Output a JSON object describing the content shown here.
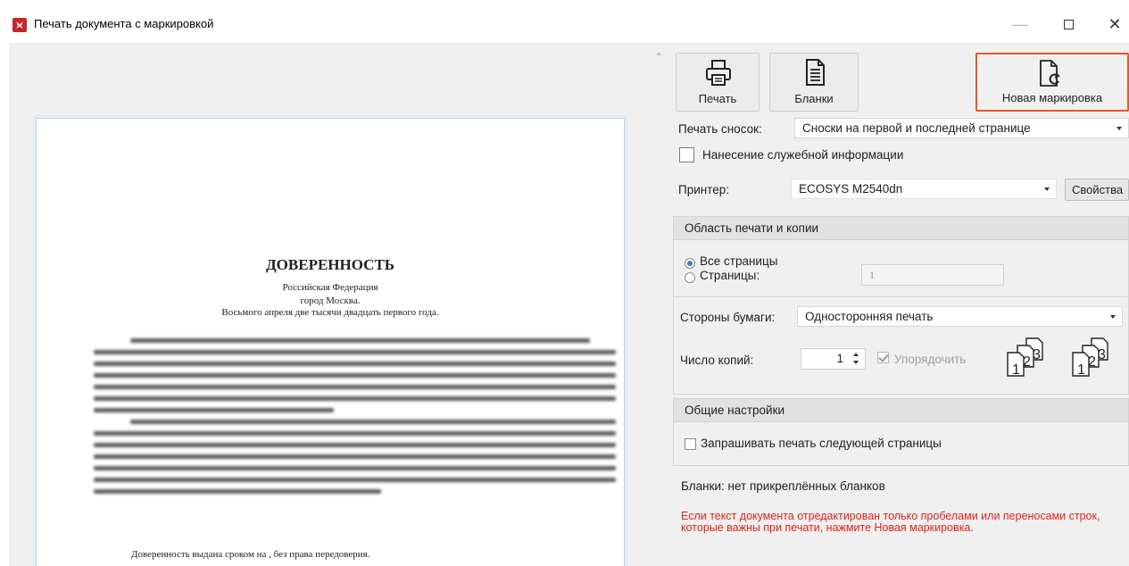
{
  "window": {
    "title": "Печать документа с маркировкой",
    "minimize_label": "—",
    "close_label": "✕"
  },
  "preview": {
    "doc_title": "ДОВЕРЕННОСТЬ",
    "line1": "Российская Федерация",
    "line2": "город Москва.",
    "line3": "Восьмого апреля две тысячи двадцать первого года.",
    "footer": "Доверенность выдана сроком на , без права передоверия."
  },
  "toolbar": {
    "print_label": "Печать",
    "blanks_label": "Бланки",
    "new_marking_label": "Новая маркировка",
    "highlight_color": "#e8572b"
  },
  "options": {
    "footnotes_label": "Печать сносок:",
    "footnotes_value": "Сноски на первой и последней странице",
    "service_info_label": "Нанесение служебной информации",
    "printer_label": "Принтер:",
    "printer_value": "ECOSYS M2540dn",
    "properties_label": "Свойства"
  },
  "print_area": {
    "header": "Область печати и копии",
    "all_pages_label": "Все страницы",
    "pages_label": "Страницы:",
    "pages_value": "1",
    "sides_label": "Стороны бумаги:",
    "sides_value": "Односторонняя печать",
    "copies_label": "Число копий:",
    "copies_value": "1",
    "collate_label": "Упорядочить"
  },
  "general": {
    "header": "Общие настройки",
    "ask_next_page_label": "Запрашивать печать следующей страницы"
  },
  "status": {
    "blanks_text": "Бланки: нет прикреплённых бланков",
    "warning_text": "Если текст документа отредактирован только пробелами или переносами строк, которые важны при печати, нажмите Новая маркировка.",
    "warning_color": "#e0201a"
  }
}
